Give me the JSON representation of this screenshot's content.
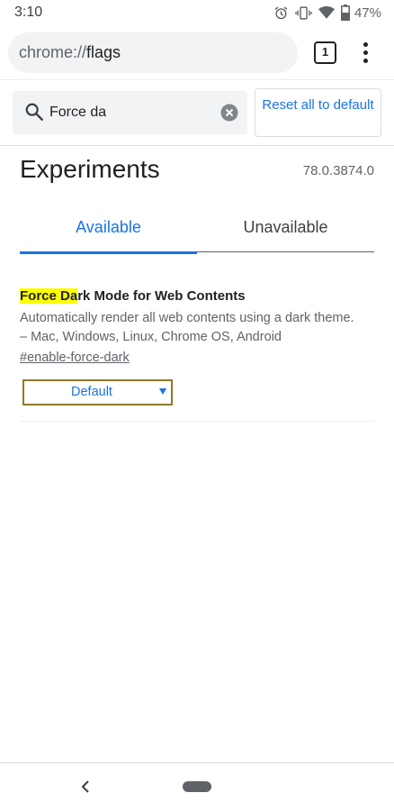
{
  "status_bar": {
    "time": "3:10",
    "battery_percent": "47%",
    "icons": [
      "alarm-icon",
      "vibrate-icon",
      "wifi-icon",
      "battery-icon"
    ]
  },
  "toolbar": {
    "url_scheme": "chrome://",
    "url_host": "flags",
    "tab_count": "1",
    "menu_icon": "more-vert-icon"
  },
  "search": {
    "value": "Force da",
    "search_icon": "search-icon",
    "clear_icon": "clear-icon",
    "reset_label": "Reset all to default"
  },
  "header": {
    "title": "Experiments",
    "version": "78.0.3874.0"
  },
  "tabs": [
    {
      "label": "Available",
      "active": true
    },
    {
      "label": "Unavailable",
      "active": false
    }
  ],
  "experiments": [
    {
      "title_match": "Force Da",
      "title_rest": "rk Mode for Web Contents",
      "description": "Automatically render all web contents using a dark theme.",
      "platforms": "– Mac, Windows, Linux, Chrome OS, Android",
      "link": "#enable-force-dark",
      "selected": "Default"
    }
  ],
  "colors": {
    "accent": "#1a73e8",
    "highlight": "#ffff00",
    "omnibox_bg": "#f1f3f4"
  },
  "nav_bar": {
    "icons": [
      "back-icon",
      "home-pill-icon"
    ]
  }
}
